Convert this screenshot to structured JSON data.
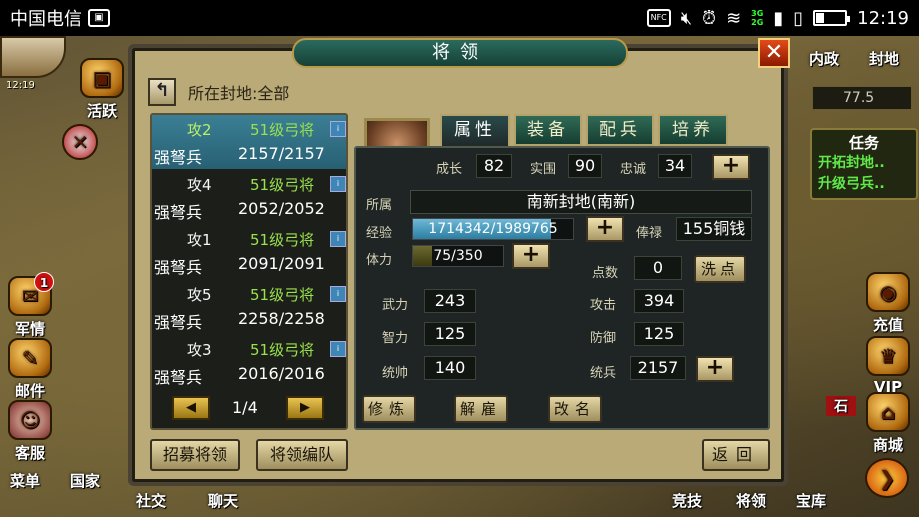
{
  "status_bar": {
    "carrier": "中国电信",
    "time": "12:19",
    "nfc": "NFC",
    "net_top": "3G",
    "net_bottom": "2G"
  },
  "hud": {
    "level_text": "12:19",
    "left_buttons": [
      {
        "label": "活跃",
        "icon": "chest-icon"
      },
      {
        "label": "军情",
        "icon": "scroll-icon",
        "badge": "1"
      },
      {
        "label": "邮件",
        "icon": "mail-icon"
      },
      {
        "label": "客服",
        "icon": "advisor-icon"
      }
    ],
    "right_top": {
      "label_1": "内政",
      "label_2": "封地",
      "coord": "77.5"
    },
    "quest": {
      "title": "任务",
      "items": [
        "开拓封地..",
        "升级弓兵.."
      ]
    },
    "right_buttons": [
      {
        "label": "充值",
        "icon": "coin-icon"
      },
      {
        "label": "VIP",
        "icon": "vip-icon"
      },
      {
        "label": "商城",
        "icon": "shop-icon"
      }
    ],
    "side_fragment": "石",
    "bottom": [
      "菜单",
      "国家",
      "社交",
      "聊天",
      "竞技",
      "将领",
      "宝库"
    ]
  },
  "panel": {
    "title": "将领",
    "fief_label": "所在封地:全部",
    "generals": [
      {
        "atk": "攻2",
        "level": "51级弓将",
        "type": "强弩兵",
        "count": "2157/2157",
        "selected": true
      },
      {
        "atk": "攻4",
        "level": "51级弓将",
        "type": "强弩兵",
        "count": "2052/2052"
      },
      {
        "atk": "攻1",
        "level": "51级弓将",
        "type": "强弩兵",
        "count": "2091/2091"
      },
      {
        "atk": "攻5",
        "level": "51级弓将",
        "type": "强弩兵",
        "count": "2258/2258"
      },
      {
        "atk": "攻3",
        "level": "51级弓将",
        "type": "强弩兵",
        "count": "2016/2016"
      }
    ],
    "page": "1/4",
    "buttons": {
      "recruit": "招募将领",
      "formation": "将领编队",
      "back": "返回"
    },
    "tabs": [
      "属性",
      "装备",
      "配兵",
      "培养"
    ],
    "detail": {
      "growth_label": "成长",
      "growth": "82",
      "real_label": "实围",
      "real": "90",
      "loyalty_label": "忠诚",
      "loyalty": "34",
      "belong_label": "所属",
      "belong": "南新封地(南新)",
      "exp_label": "经验",
      "exp": "1714342/1989765",
      "exp_fraction": 0.8615,
      "salary_label": "俸禄",
      "salary": "155铜钱",
      "hp_label": "体力",
      "hp": "75/350",
      "hp_fraction": 0.2143,
      "points_label": "点数",
      "points": "0",
      "reset": "洗点",
      "wu_label": "武力",
      "wu": "243",
      "atk_label": "攻击",
      "atk": "394",
      "zhi_label": "智力",
      "zhi": "125",
      "def_label": "防御",
      "def": "125",
      "tong_label": "统帅",
      "tong": "140",
      "bing_label": "统兵",
      "bing": "2157",
      "actions": [
        "修炼",
        "解雇",
        "改名"
      ]
    }
  }
}
